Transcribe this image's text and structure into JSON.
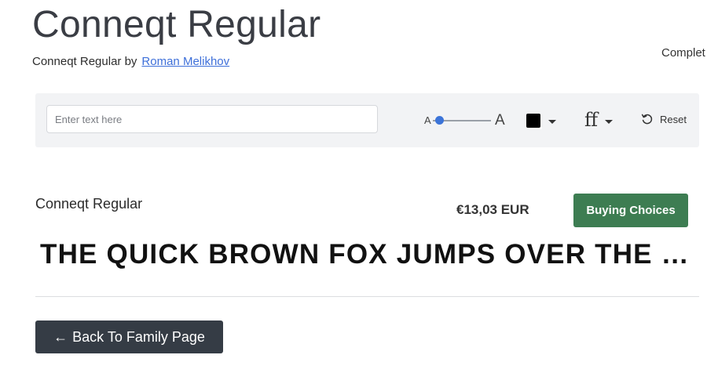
{
  "header": {
    "title": "Conneqt Regular",
    "byline_prefix": "Conneqt Regular by",
    "author": "Roman Melikhov",
    "right_text": "Complet"
  },
  "toolbar": {
    "input_placeholder": "Enter text here",
    "input_value": "",
    "size_small_label": "A",
    "size_large_label": "A",
    "size_slider_level": 0.12,
    "text_color": "#000000",
    "ff_label": "ff",
    "reset_label": "Reset"
  },
  "product": {
    "name": "Conneqt Regular",
    "price": "€13,03 EUR",
    "buy_label": "Buying Choices",
    "buy_color": "#3d7d52"
  },
  "preview": {
    "text": "THE QUICK BROWN FOX JUMPS OVER THE LAZY DOG"
  },
  "footer": {
    "back_arrow": "←",
    "back_label": "Back To Family Page"
  },
  "icons": {
    "color_caret": "chevron-down-icon",
    "features": "font-features-icon",
    "features_caret": "chevron-down-icon",
    "reset": "reset-icon",
    "back": "arrow-left-icon"
  }
}
